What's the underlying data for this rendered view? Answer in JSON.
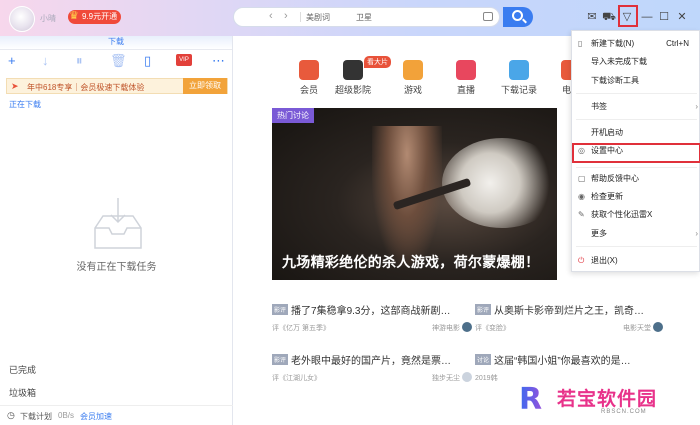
{
  "header": {
    "user_name": "小晴",
    "vip_badge": "9.9元开通",
    "search_tag": "美剧词",
    "search_tag2": "卫星",
    "icons": [
      "mail-icon",
      "shirt-icon",
      "dropdown-menu-icon",
      "minimize-icon",
      "maximize-icon",
      "close-icon"
    ]
  },
  "left": {
    "tab": "下载",
    "promo_text": "年中618专享｜会员极速下载体验",
    "promo_button": "立即领取",
    "downloading": "正在下载",
    "empty_text": "没有正在下载任务",
    "completed": "已完成",
    "trash": "垃圾箱",
    "plan": "下载计划",
    "speed": "0B/s",
    "accel": "会员加速"
  },
  "categories": [
    {
      "label": "会员",
      "color": "#e85a3c"
    },
    {
      "label": "超级影院",
      "color": "#333333"
    },
    {
      "label": "游戏",
      "color": "#f2a23a"
    },
    {
      "label": "直播",
      "color": "#e8475e"
    },
    {
      "label": "下载记录",
      "color": "#4aa6e8"
    },
    {
      "label": "电影",
      "color": "#e85a3c"
    }
  ],
  "hot_tag": "看大片",
  "hero": {
    "chip": "热门讨论",
    "caption": "九场精彩绝伦的杀人游戏，荷尔蒙爆棚！"
  },
  "news": [
    {
      "tag": "影评",
      "title": "播了7集稳拿9.3分，这部商战新剧…",
      "sub": "评《亿万 第五季》",
      "source": "神游电影"
    },
    {
      "tag": "影评",
      "title": "从奥斯卡影帝到烂片之王，凯奇…",
      "sub": "评《变脸》",
      "source": "电影天堂"
    },
    {
      "tag": "影评",
      "title": "老外眼中最好的国产片，竟然是票…",
      "sub": "评《江湖儿女》",
      "source": "独步无尘"
    },
    {
      "tag": "讨论",
      "title": "这届“韩国小姐”你最喜欢的是…",
      "sub": "2019韩",
      "source": ""
    }
  ],
  "menu": [
    {
      "label": "新建下载(N)",
      "shortcut": "Ctrl+N",
      "icon": "new-download-icon"
    },
    {
      "label": "导入未完成下载",
      "shortcut": "",
      "icon": ""
    },
    {
      "label": "下载诊断工具",
      "shortcut": "",
      "icon": ""
    },
    {
      "label": "书签",
      "shortcut": "",
      "icon": ""
    },
    {
      "label": "开机启动",
      "shortcut": "",
      "icon": ""
    },
    {
      "label": "设置中心",
      "shortcut": "",
      "icon": "settings-icon"
    },
    {
      "label": "帮助反馈中心",
      "shortcut": "",
      "icon": "help-icon"
    },
    {
      "label": "检查更新",
      "shortcut": "",
      "icon": "update-icon"
    },
    {
      "label": "获取个性化迅雷X",
      "shortcut": "",
      "icon": "customize-icon"
    },
    {
      "label": "更多",
      "shortcut": "",
      "icon": ""
    },
    {
      "label": "退出(X)",
      "shortcut": "",
      "icon": "power-icon"
    }
  ],
  "watermark": {
    "logo": "R",
    "text": "若宝软件园",
    "sub": "RBSCN.COM"
  }
}
